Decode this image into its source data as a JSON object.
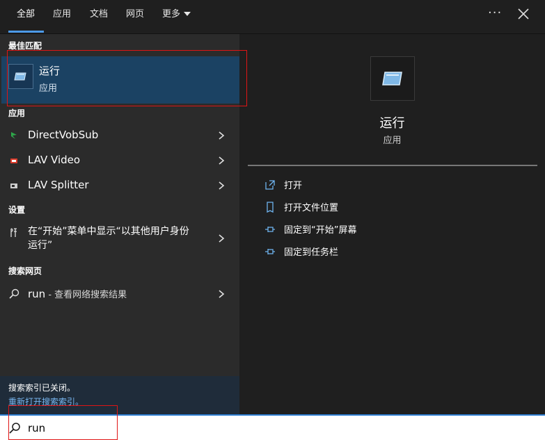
{
  "tabs": [
    {
      "label": "全部",
      "active": true
    },
    {
      "label": "应用"
    },
    {
      "label": "文档"
    },
    {
      "label": "网页"
    },
    {
      "label": "更多"
    }
  ],
  "window_controls": {
    "more_options": "···",
    "close": "close-icon"
  },
  "sections": {
    "best_match": "最佳匹配",
    "apps": "应用",
    "settings": "设置",
    "web": "搜索网页"
  },
  "best_match": {
    "title": "运行",
    "subtitle": "应用",
    "icon": "run-icon"
  },
  "apps": [
    {
      "label": "DirectVobSub",
      "icon": "directvobsub-icon",
      "icon_color": "#2ea84a"
    },
    {
      "label": "LAV Video",
      "icon": "lav-video-icon",
      "icon_color": "#d93a2a"
    },
    {
      "label": "LAV Splitter",
      "icon": "lav-splitter-icon",
      "icon_color": "#cfcfcf"
    }
  ],
  "settings_items": [
    {
      "line1": "在“开始”菜单中显示“以其他用户身份",
      "line2": "运行”",
      "icon": "settings-icon"
    }
  ],
  "web_search": {
    "query": "run",
    "suffix": " - 查看网络搜索结果",
    "icon": "search-icon"
  },
  "index_note": {
    "text": "搜索索引已关闭。",
    "link": "重新打开搜索索引。"
  },
  "preview": {
    "title": "运行",
    "subtitle": "应用",
    "icon": "run-icon",
    "actions": [
      {
        "label": "打开",
        "icon": "open-icon"
      },
      {
        "label": "打开文件位置",
        "icon": "file-location-icon"
      },
      {
        "label": "固定到“开始”屏幕",
        "icon": "pin-start-icon"
      },
      {
        "label": "固定到任务栏",
        "icon": "pin-taskbar-icon"
      }
    ]
  },
  "search": {
    "value": "run",
    "placeholder": ""
  },
  "colors": {
    "accent": "#4c9ae8",
    "selected_bg": "#1b4263",
    "highlight": "#e01515",
    "link": "#78b6f0"
  }
}
